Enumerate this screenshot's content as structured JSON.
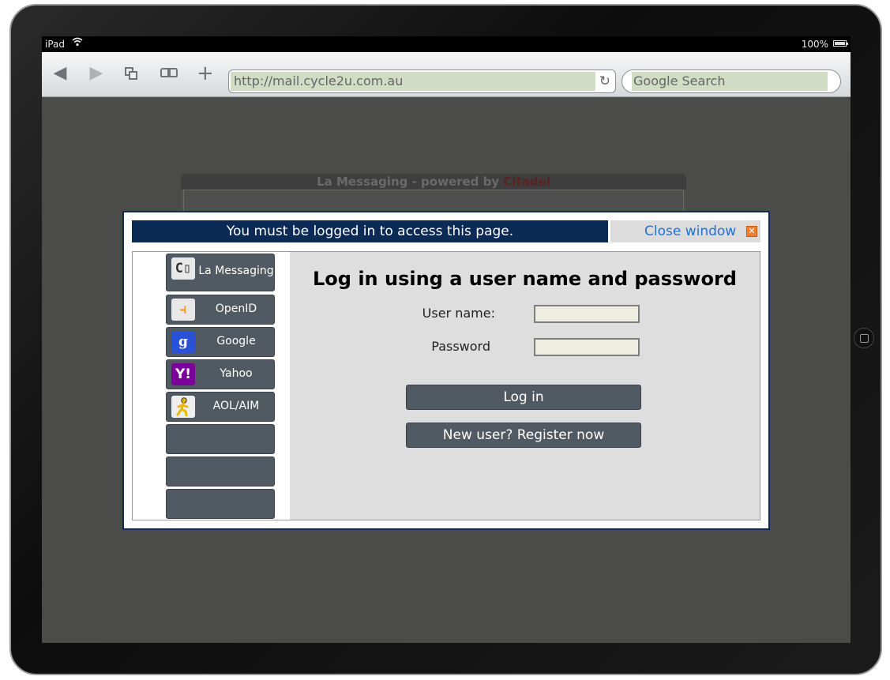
{
  "statusbar": {
    "device": "iPad",
    "battery": "100%"
  },
  "browser": {
    "url": "http://mail.cycle2u.com.au",
    "search_placeholder": "Google Search"
  },
  "background_page": {
    "title": "La Messaging - powered by ",
    "brand": "Citadel"
  },
  "dialog": {
    "notice": "You must be logged in to access this page.",
    "close_label": "Close window",
    "providers": [
      {
        "label": "La Messaging",
        "icon": "citadel-icon"
      },
      {
        "label": "OpenID",
        "icon": "openid-icon"
      },
      {
        "label": "Google",
        "icon": "google-icon"
      },
      {
        "label": "Yahoo",
        "icon": "yahoo-icon"
      },
      {
        "label": "AOL/AIM",
        "icon": "aol-aim-icon"
      },
      {
        "label": ""
      },
      {
        "label": ""
      },
      {
        "label": ""
      }
    ],
    "login": {
      "title": "Log in using a user name and password",
      "username_label": "User name:",
      "password_label": "Password",
      "username_value": "",
      "password_value": "",
      "login_button": "Log in",
      "register_button": "New user? Register now"
    }
  },
  "colors": {
    "notice_bg": "#0b2a55",
    "button_bg": "#515a63",
    "link": "#1f72d4"
  }
}
